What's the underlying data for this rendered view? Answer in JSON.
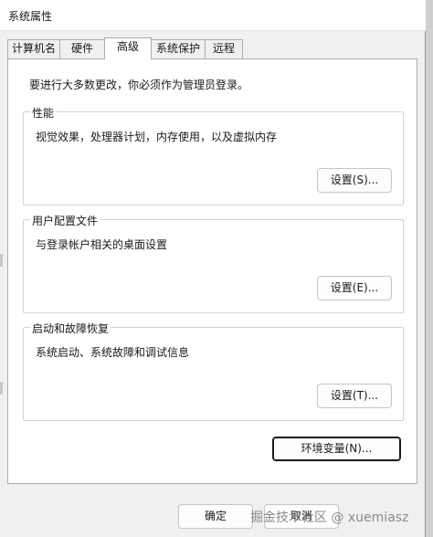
{
  "window": {
    "title": "系统属性"
  },
  "tabs": [
    {
      "label": "计算机名",
      "active": false
    },
    {
      "label": "硬件",
      "active": false
    },
    {
      "label": "高级",
      "active": true
    },
    {
      "label": "系统保护",
      "active": false
    },
    {
      "label": "远程",
      "active": false
    }
  ],
  "advanced": {
    "admin_note": "要进行大多数更改，你必须作为管理员登录。",
    "performance": {
      "title": "性能",
      "description": "视觉效果，处理器计划，内存使用，以及虚拟内存",
      "button": "设置(S)..."
    },
    "user_profiles": {
      "title": "用户配置文件",
      "description": "与登录帐户相关的桌面设置",
      "button": "设置(E)..."
    },
    "startup_recovery": {
      "title": "启动和故障恢复",
      "description": "系统启动、系统故障和调试信息",
      "button": "设置(T)..."
    },
    "env_vars_button": "环境变量(N)..."
  },
  "footer": {
    "ok": "确定",
    "cancel": "取消"
  },
  "watermark": "掘金技术社区 @ xuemiasz"
}
